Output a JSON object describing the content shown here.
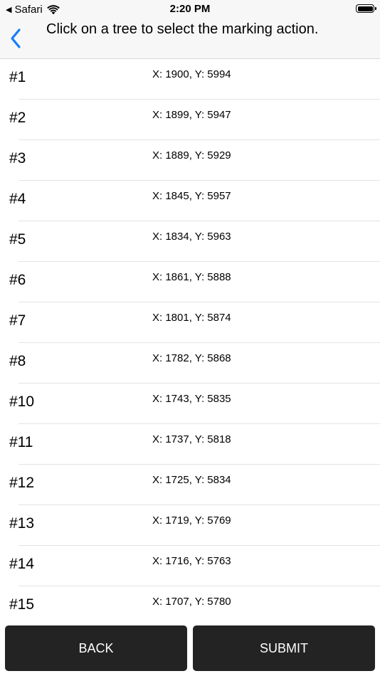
{
  "status_bar": {
    "carrier": "Safari",
    "time": "2:20 PM"
  },
  "nav": {
    "title": "Click on a tree to select the marking action.",
    "back_icon": "chevron-left-icon",
    "accent_color": "#157efb"
  },
  "trees": [
    {
      "id": "#1",
      "coords": "X: 1900, Y: 5994"
    },
    {
      "id": "#2",
      "coords": "X: 1899, Y: 5947"
    },
    {
      "id": "#3",
      "coords": "X: 1889, Y: 5929"
    },
    {
      "id": "#4",
      "coords": "X: 1845, Y: 5957"
    },
    {
      "id": "#5",
      "coords": "X: 1834, Y: 5963"
    },
    {
      "id": "#6",
      "coords": "X: 1861, Y: 5888"
    },
    {
      "id": "#7",
      "coords": "X: 1801, Y: 5874"
    },
    {
      "id": "#8",
      "coords": "X: 1782, Y: 5868"
    },
    {
      "id": "#10",
      "coords": "X: 1743, Y: 5835"
    },
    {
      "id": "#11",
      "coords": "X: 1737, Y: 5818"
    },
    {
      "id": "#12",
      "coords": "X: 1725, Y: 5834"
    },
    {
      "id": "#13",
      "coords": "X: 1719, Y: 5769"
    },
    {
      "id": "#14",
      "coords": "X: 1716, Y: 5763"
    },
    {
      "id": "#15",
      "coords": "X: 1707, Y: 5780"
    }
  ],
  "footer": {
    "back_label": "BACK",
    "submit_label": "SUBMIT"
  }
}
